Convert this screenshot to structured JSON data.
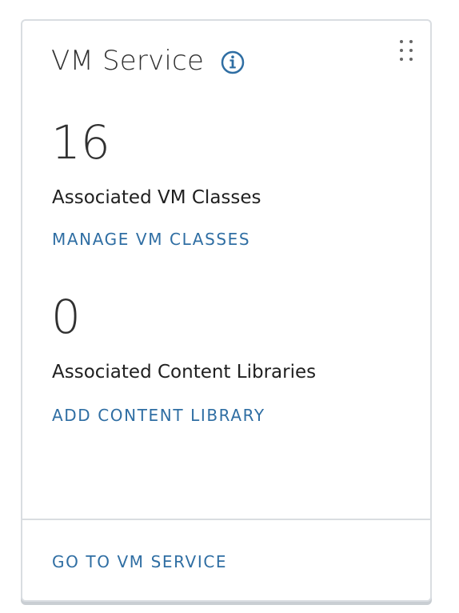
{
  "card": {
    "title": "VM Service",
    "icons": {
      "info": "info-icon",
      "drag": "drag-handle-icon"
    }
  },
  "metrics": [
    {
      "value": "16",
      "label": "Associated VM Classes",
      "action": "MANAGE VM CLASSES"
    },
    {
      "value": "0",
      "label": "Associated Content Libraries",
      "action": "ADD CONTENT LIBRARY"
    }
  ],
  "footer": {
    "link": "GO TO VM SERVICE"
  },
  "colors": {
    "accent": "#2f6ea3",
    "text_primary": "#313131",
    "border": "#d9dde1"
  }
}
